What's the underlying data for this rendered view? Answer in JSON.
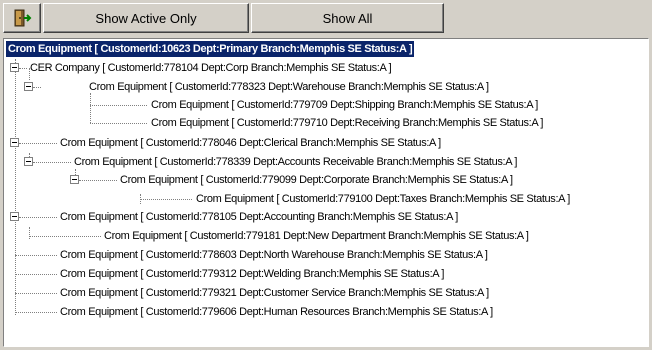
{
  "toolbar": {
    "icon_name": "exit-door-icon",
    "active_label": "Show Active Only",
    "all_label": "Show All"
  },
  "tree": {
    "rows": [
      "Crom Equipment [ CustomerId:10623 Dept:Primary Branch:Memphis SE Status:A ]",
      "CER Company [ CustomerId:778104 Dept:Corp Branch:Memphis SE Status:A ]",
      "Crom Equipment [ CustomerId:778323 Dept:Warehouse Branch:Memphis SE Status:A ]",
      "Crom Equipment [ CustomerId:779709 Dept:Shipping Branch:Memphis SE Status:A ]",
      "Crom Equipment [ CustomerId:779710 Dept:Receiving Branch:Memphis SE Status:A ]",
      "Crom Equipment [ CustomerId:778046 Dept:Clerical Branch:Memphis SE Status:A ]",
      "Crom Equipment [ CustomerId:778339 Dept:Accounts Receivable Branch:Memphis SE Status:A ]",
      "Crom Equipment [ CustomerId:779099 Dept:Corporate Branch:Memphis SE Status:A ]",
      "Crom Equipment [ CustomerId:779100 Dept:Taxes Branch:Memphis SE Status:A ]",
      "Crom Equipment [ CustomerId:778105 Dept:Accounting Branch:Memphis SE Status:A ]",
      "Crom Equipment [ CustomerId:779181 Dept:New Department Branch:Memphis SE Status:A ]",
      "Crom Equipment [ CustomerId:778603 Dept:North Warehouse Branch:Memphis SE Status:A ]",
      "Crom Equipment [ CustomerId:779312 Dept:Welding  Branch:Memphis SE Status:A ]",
      "Crom Equipment [ CustomerId:779321 Dept:Customer Service Branch:Memphis SE Status:A ]",
      "Crom Equipment [ CustomerId:779606 Dept:Human Resources Branch:Memphis SE Status:A ]"
    ]
  }
}
